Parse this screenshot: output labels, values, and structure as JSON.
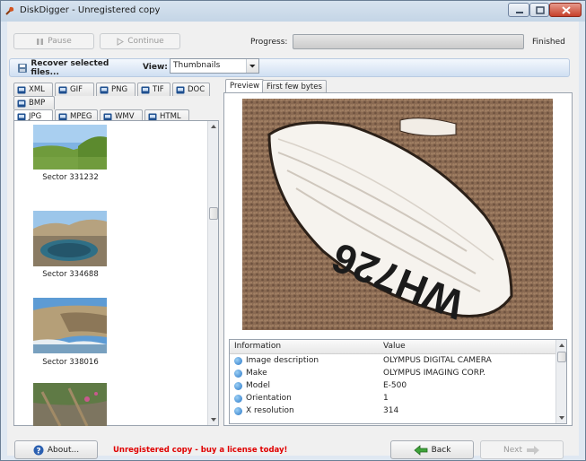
{
  "window": {
    "title": "DiskDigger - Unregistered copy"
  },
  "toolbar": {
    "pause_label": "Pause",
    "continue_label": "Continue",
    "progress_label": "Progress:",
    "progress_value": 1.0,
    "status_text": "Finished"
  },
  "actionbar": {
    "recover_label": "Recover selected files...",
    "view_label": "View:",
    "view_value": "Thumbnails"
  },
  "filetypes": {
    "row1": [
      {
        "label": "XML"
      },
      {
        "label": "GIF"
      },
      {
        "label": "PNG"
      },
      {
        "label": "TIF"
      },
      {
        "label": "DOC"
      }
    ],
    "row2": [
      {
        "label": "BMP"
      }
    ],
    "row3": [
      {
        "label": "JPG"
      },
      {
        "label": "MPEG"
      },
      {
        "label": "WMV"
      },
      {
        "label": "HTML"
      }
    ],
    "selected": "JPG"
  },
  "thumbnails": [
    {
      "caption": "Sector 331232"
    },
    {
      "caption": "Sector 334688"
    },
    {
      "caption": "Sector 338016"
    },
    {
      "caption": ""
    }
  ],
  "preview": {
    "tabs": [
      {
        "label": "Preview"
      },
      {
        "label": "First few bytes"
      }
    ],
    "selected_tab": "Preview",
    "hull_text": "WH726",
    "info_headers": {
      "key": "Information",
      "value": "Value"
    },
    "info": [
      {
        "key": "Image description",
        "value": "OLYMPUS DIGITAL CAMERA"
      },
      {
        "key": "Make",
        "value": "OLYMPUS IMAGING CORP."
      },
      {
        "key": "Model",
        "value": "E-500"
      },
      {
        "key": "Orientation",
        "value": "1"
      },
      {
        "key": "X resolution",
        "value": "314"
      }
    ]
  },
  "footer": {
    "about_label": "About...",
    "warning": "Unregistered copy - buy a license today!",
    "back_label": "Back",
    "next_label": "Next"
  },
  "colors": {
    "warning": "#e00000",
    "accent": "#2a78c8"
  },
  "icons": {
    "app": "shovel-icon",
    "pause": "pause-icon",
    "continue": "play-icon",
    "recover": "disk-save-icon",
    "back": "arrow-left-icon",
    "next": "arrow-right-icon",
    "about": "question-icon"
  }
}
